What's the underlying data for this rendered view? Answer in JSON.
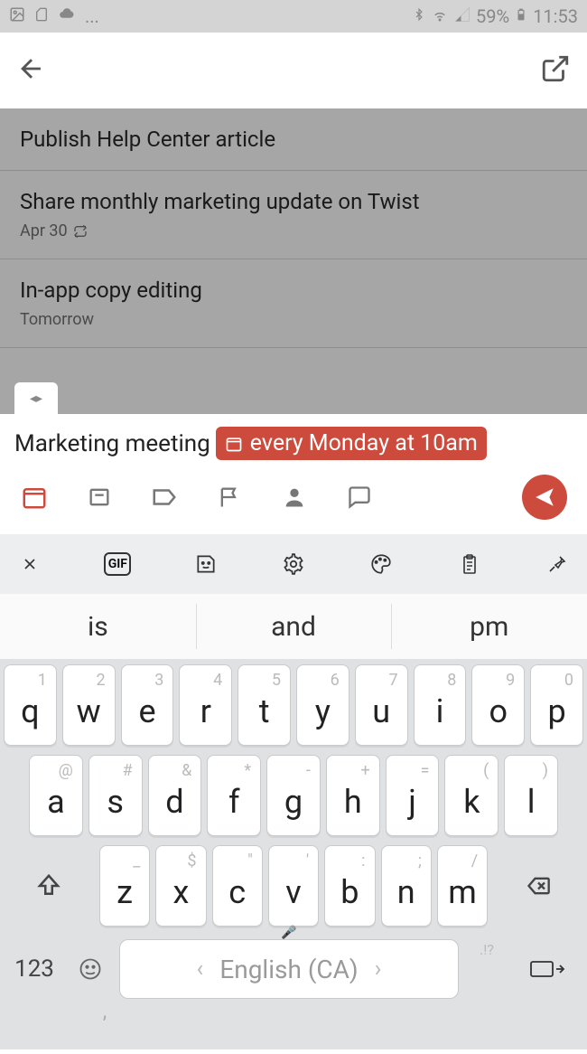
{
  "status_bar": {
    "battery": "59%",
    "time": "11:53",
    "ellipsis": "..."
  },
  "tasks": [
    {
      "title": "Publish Help Center article",
      "meta": ""
    },
    {
      "title": "Share monthly marketing update on Twist",
      "meta": "Apr 30"
    },
    {
      "title": "In-app copy editing",
      "meta": "Tomorrow"
    }
  ],
  "compose": {
    "text": "Marketing meeting",
    "chip": "every Monday at 10am"
  },
  "suggestions": [
    "is",
    "and",
    "pm"
  ],
  "keyboard": {
    "row1": [
      {
        "sec": "1",
        "main": "q"
      },
      {
        "sec": "2",
        "main": "w"
      },
      {
        "sec": "3",
        "main": "e"
      },
      {
        "sec": "4",
        "main": "r"
      },
      {
        "sec": "5",
        "main": "t"
      },
      {
        "sec": "6",
        "main": "y"
      },
      {
        "sec": "7",
        "main": "u"
      },
      {
        "sec": "8",
        "main": "i"
      },
      {
        "sec": "9",
        "main": "o"
      },
      {
        "sec": "0",
        "main": "p"
      }
    ],
    "row2": [
      {
        "sec": "@",
        "main": "a"
      },
      {
        "sec": "#",
        "main": "s"
      },
      {
        "sec": "&",
        "main": "d"
      },
      {
        "sec": "*",
        "main": "f"
      },
      {
        "sec": "-",
        "main": "g"
      },
      {
        "sec": "+",
        "main": "h"
      },
      {
        "sec": "=",
        "main": "j"
      },
      {
        "sec": "(",
        "main": "k"
      },
      {
        "sec": ")",
        "main": "l"
      }
    ],
    "row3": [
      {
        "sec": "_",
        "main": "z"
      },
      {
        "sec": "$",
        "main": "x"
      },
      {
        "sec": "\"",
        "main": "c"
      },
      {
        "sec": "'",
        "main": "v"
      },
      {
        "sec": ":",
        "main": "b"
      },
      {
        "sec": ";",
        "main": "n"
      },
      {
        "sec": "/",
        "main": "m"
      }
    ],
    "numlabel": "123",
    "space_label": "English (CA)",
    "punct_hint": ".!?"
  }
}
